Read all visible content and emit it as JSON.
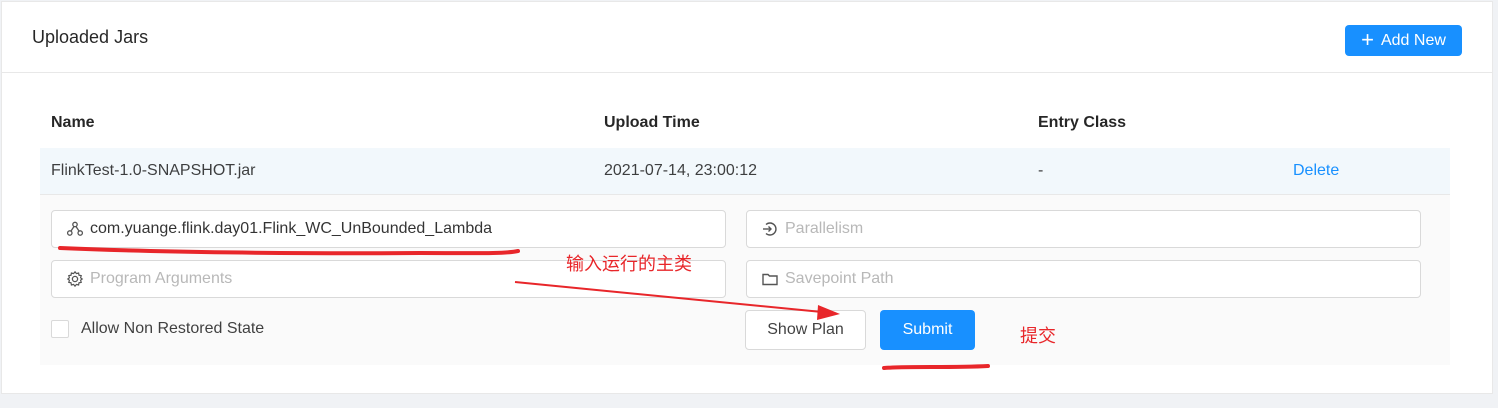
{
  "card": {
    "title": "Uploaded Jars"
  },
  "toolbar": {
    "add_new_label": "Add New"
  },
  "table": {
    "columns": [
      "Name",
      "Upload Time",
      "Entry Class"
    ],
    "rows": [
      {
        "name": "FlinkTest-1.0-SNAPSHOT.jar",
        "upload_time": "2021-07-14, 23:00:12",
        "entry_class": "-",
        "action": "Delete"
      }
    ]
  },
  "submit_form": {
    "entry_class_value": "com.yuange.flink.day01.Flink_WC_UnBounded_Lambda",
    "parallelism_placeholder": "Parallelism",
    "program_arguments_placeholder": "Program Arguments",
    "savepoint_path_placeholder": "Savepoint Path",
    "allow_non_restored_label": "Allow Non Restored State",
    "allow_non_restored_checked": false,
    "show_plan_label": "Show Plan",
    "submit_label": "Submit"
  },
  "annotations": {
    "main_class_note": "输入运行的主类",
    "submit_note": "提交",
    "color": "#e8262a"
  },
  "colors": {
    "accent": "#1890ff",
    "row_highlight": "#f2f8fc"
  }
}
